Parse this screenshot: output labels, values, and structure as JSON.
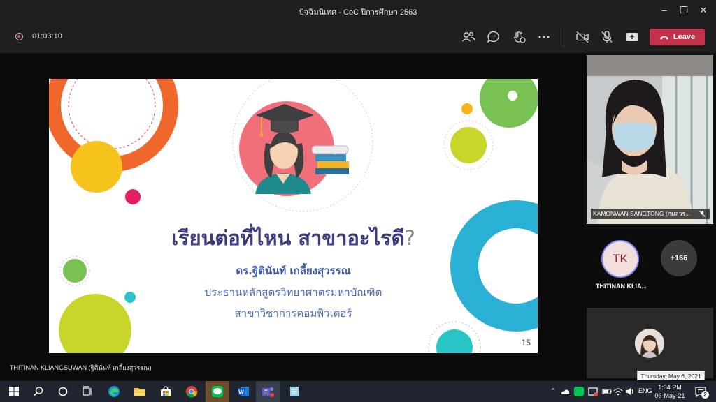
{
  "window": {
    "title": "ปัจฉิมนิเทศ - CoC ปีการศึกษา 2563",
    "controls": [
      "minimize-icon",
      "maximize-icon",
      "close-icon"
    ]
  },
  "call": {
    "timer": "01:03:10",
    "leave_label": "Leave",
    "leave_color": "#c4314b",
    "controls": [
      "participants-icon",
      "chat-icon",
      "reactions-icon",
      "more-options-icon",
      "camera-off-icon",
      "mic-off-icon",
      "share-screen-icon"
    ]
  },
  "slide": {
    "title": "เรียนต่อที่ไหน สาขาอะไรดี",
    "title_mark": "?",
    "author": "ดร.ฐิตินันท์ เกลี้ยงสุวรรณ",
    "line1": "ประธานหลักสูตรวิทยาศาตรมหาบัณฑิต",
    "line2": "สาขาวิชาการคอมพิวเตอร์",
    "page": "15"
  },
  "presenter_name": "THITINAN KLIANGSUWAN (ฐิตินันท์ เกลี้ยงสุวรรณ)",
  "participants": {
    "video_label": "KAMONWAN SANGTONG (กมลวร...",
    "avatar_initials": "TK",
    "avatar_name": "THITINAN KLIA...",
    "more_count": "+166"
  },
  "tooltip": "Thursday, May 6, 2021",
  "taskbar": {
    "apps": [
      "windows-start-icon",
      "search-icon",
      "cortana-icon",
      "task-view-icon",
      "edge-icon",
      "file-explorer-icon",
      "store-icon",
      "chrome-icon",
      "line-icon",
      "word-icon",
      "teams-icon",
      "notepad-icon"
    ],
    "lang": "ENG",
    "time": "1:34 PM",
    "date": "06-May-21",
    "notifications": "2"
  }
}
